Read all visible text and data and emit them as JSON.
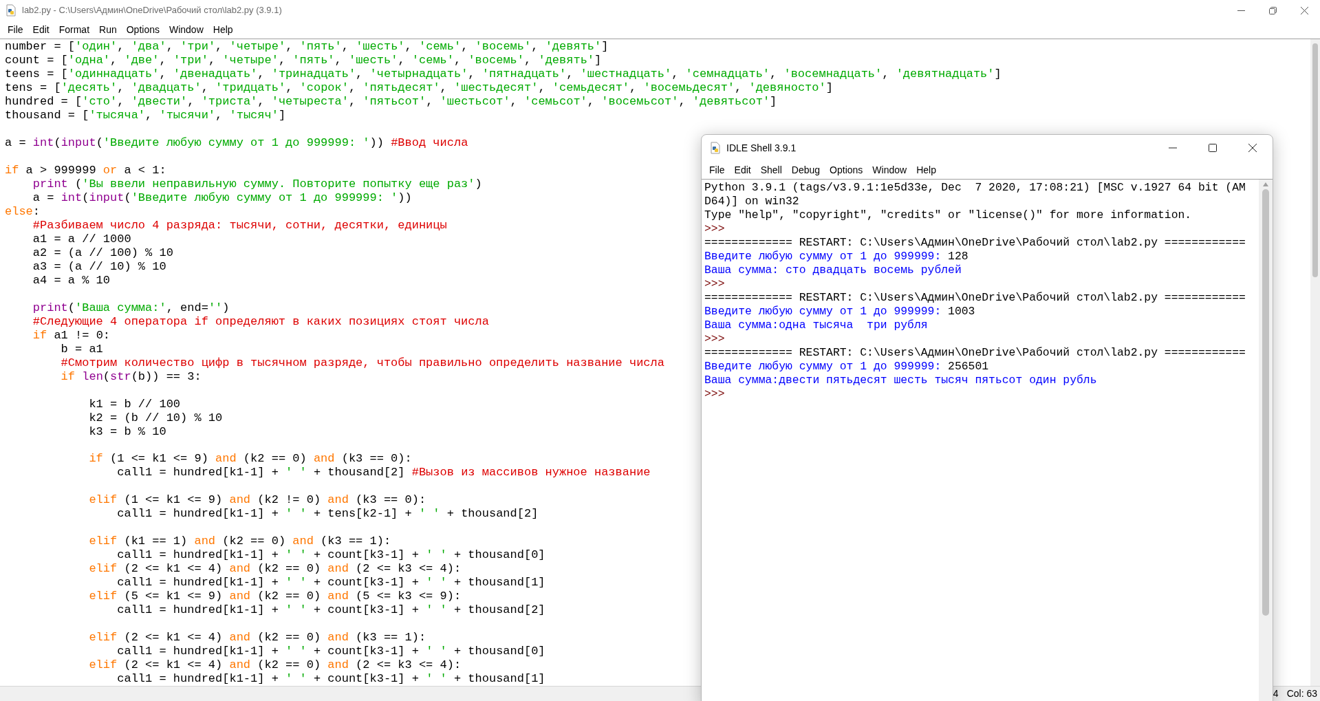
{
  "editor": {
    "title": "lab2.py - C:\\Users\\Админ\\OneDrive\\Рабочий стол\\lab2.py (3.9.1)",
    "menu": [
      "File",
      "Edit",
      "Format",
      "Run",
      "Options",
      "Window",
      "Help"
    ],
    "lines": [
      {
        "kind": "code",
        "tokens": [
          {
            "kind": "plain",
            "text": "number = ["
          },
          {
            "kind": "str",
            "text": "'один'"
          },
          {
            "kind": "plain",
            "text": ", "
          },
          {
            "kind": "str",
            "text": "'два'"
          },
          {
            "kind": "plain",
            "text": ", "
          },
          {
            "kind": "str",
            "text": "'три'"
          },
          {
            "kind": "plain",
            "text": ", "
          },
          {
            "kind": "str",
            "text": "'четыре'"
          },
          {
            "kind": "plain",
            "text": ", "
          },
          {
            "kind": "str",
            "text": "'пять'"
          },
          {
            "kind": "plain",
            "text": ", "
          },
          {
            "kind": "str",
            "text": "'шесть'"
          },
          {
            "kind": "plain",
            "text": ", "
          },
          {
            "kind": "str",
            "text": "'семь'"
          },
          {
            "kind": "plain",
            "text": ", "
          },
          {
            "kind": "str",
            "text": "'восемь'"
          },
          {
            "kind": "plain",
            "text": ", "
          },
          {
            "kind": "str",
            "text": "'девять'"
          },
          {
            "kind": "plain",
            "text": "]"
          }
        ]
      },
      {
        "kind": "code",
        "tokens": [
          {
            "kind": "plain",
            "text": "count = ["
          },
          {
            "kind": "str",
            "text": "'одна'"
          },
          {
            "kind": "plain",
            "text": ", "
          },
          {
            "kind": "str",
            "text": "'две'"
          },
          {
            "kind": "plain",
            "text": ", "
          },
          {
            "kind": "str",
            "text": "'три'"
          },
          {
            "kind": "plain",
            "text": ", "
          },
          {
            "kind": "str",
            "text": "'четыре'"
          },
          {
            "kind": "plain",
            "text": ", "
          },
          {
            "kind": "str",
            "text": "'пять'"
          },
          {
            "kind": "plain",
            "text": ", "
          },
          {
            "kind": "str",
            "text": "'шесть'"
          },
          {
            "kind": "plain",
            "text": ", "
          },
          {
            "kind": "str",
            "text": "'семь'"
          },
          {
            "kind": "plain",
            "text": ", "
          },
          {
            "kind": "str",
            "text": "'восемь'"
          },
          {
            "kind": "plain",
            "text": ", "
          },
          {
            "kind": "str",
            "text": "'девять'"
          },
          {
            "kind": "plain",
            "text": "]"
          }
        ]
      },
      {
        "kind": "code",
        "tokens": [
          {
            "kind": "plain",
            "text": "teens = ["
          },
          {
            "kind": "str",
            "text": "'одиннадцать'"
          },
          {
            "kind": "plain",
            "text": ", "
          },
          {
            "kind": "str",
            "text": "'двенадцать'"
          },
          {
            "kind": "plain",
            "text": ", "
          },
          {
            "kind": "str",
            "text": "'тринадцать'"
          },
          {
            "kind": "plain",
            "text": ", "
          },
          {
            "kind": "str",
            "text": "'четырнадцать'"
          },
          {
            "kind": "plain",
            "text": ", "
          },
          {
            "kind": "str",
            "text": "'пятнадцать'"
          },
          {
            "kind": "plain",
            "text": ", "
          },
          {
            "kind": "str",
            "text": "'шестнадцать'"
          },
          {
            "kind": "plain",
            "text": ", "
          },
          {
            "kind": "str",
            "text": "'семнадцать'"
          },
          {
            "kind": "plain",
            "text": ", "
          },
          {
            "kind": "str",
            "text": "'восемнадцать'"
          },
          {
            "kind": "plain",
            "text": ", "
          },
          {
            "kind": "str",
            "text": "'девятнадцать'"
          },
          {
            "kind": "plain",
            "text": "]"
          }
        ]
      },
      {
        "kind": "code",
        "tokens": [
          {
            "kind": "plain",
            "text": "tens = ["
          },
          {
            "kind": "str",
            "text": "'десять'"
          },
          {
            "kind": "plain",
            "text": ", "
          },
          {
            "kind": "str",
            "text": "'двадцать'"
          },
          {
            "kind": "plain",
            "text": ", "
          },
          {
            "kind": "str",
            "text": "'тридцать'"
          },
          {
            "kind": "plain",
            "text": ", "
          },
          {
            "kind": "str",
            "text": "'сорок'"
          },
          {
            "kind": "plain",
            "text": ", "
          },
          {
            "kind": "str",
            "text": "'пятьдесят'"
          },
          {
            "kind": "plain",
            "text": ", "
          },
          {
            "kind": "str",
            "text": "'шестьдесят'"
          },
          {
            "kind": "plain",
            "text": ", "
          },
          {
            "kind": "str",
            "text": "'семьдесят'"
          },
          {
            "kind": "plain",
            "text": ", "
          },
          {
            "kind": "str",
            "text": "'восемьдесят'"
          },
          {
            "kind": "plain",
            "text": ", "
          },
          {
            "kind": "str",
            "text": "'девяносто'"
          },
          {
            "kind": "plain",
            "text": "]"
          }
        ]
      },
      {
        "kind": "code",
        "tokens": [
          {
            "kind": "plain",
            "text": "hundred = ["
          },
          {
            "kind": "str",
            "text": "'сто'"
          },
          {
            "kind": "plain",
            "text": ", "
          },
          {
            "kind": "str",
            "text": "'двести'"
          },
          {
            "kind": "plain",
            "text": ", "
          },
          {
            "kind": "str",
            "text": "'триста'"
          },
          {
            "kind": "plain",
            "text": ", "
          },
          {
            "kind": "str",
            "text": "'четыреста'"
          },
          {
            "kind": "plain",
            "text": ", "
          },
          {
            "kind": "str",
            "text": "'пятьсот'"
          },
          {
            "kind": "plain",
            "text": ", "
          },
          {
            "kind": "str",
            "text": "'шестьсот'"
          },
          {
            "kind": "plain",
            "text": ", "
          },
          {
            "kind": "str",
            "text": "'семьсот'"
          },
          {
            "kind": "plain",
            "text": ", "
          },
          {
            "kind": "str",
            "text": "'восемьсот'"
          },
          {
            "kind": "plain",
            "text": ", "
          },
          {
            "kind": "str",
            "text": "'девятьсот'"
          },
          {
            "kind": "plain",
            "text": "]"
          }
        ]
      },
      {
        "kind": "code",
        "tokens": [
          {
            "kind": "plain",
            "text": "thousand = ["
          },
          {
            "kind": "str",
            "text": "'тысяча'"
          },
          {
            "kind": "plain",
            "text": ", "
          },
          {
            "kind": "str",
            "text": "'тысячи'"
          },
          {
            "kind": "plain",
            "text": ", "
          },
          {
            "kind": "str",
            "text": "'тысяч'"
          },
          {
            "kind": "plain",
            "text": "]"
          }
        ]
      },
      {
        "kind": "blank"
      },
      {
        "kind": "code",
        "tokens": [
          {
            "kind": "plain",
            "text": "a = "
          },
          {
            "kind": "builtin",
            "text": "int"
          },
          {
            "kind": "plain",
            "text": "("
          },
          {
            "kind": "builtin",
            "text": "input"
          },
          {
            "kind": "plain",
            "text": "("
          },
          {
            "kind": "str",
            "text": "'Введите любую сумму от 1 до 999999: '"
          },
          {
            "kind": "plain",
            "text": ")) "
          },
          {
            "kind": "comment",
            "text": "#Ввод числа"
          }
        ]
      },
      {
        "kind": "blank"
      },
      {
        "kind": "code",
        "tokens": [
          {
            "kind": "keyword",
            "text": "if"
          },
          {
            "kind": "plain",
            "text": " a > 999999 "
          },
          {
            "kind": "keyword",
            "text": "or"
          },
          {
            "kind": "plain",
            "text": " a < 1:"
          }
        ]
      },
      {
        "kind": "code",
        "tokens": [
          {
            "kind": "builtin",
            "text": "    print"
          },
          {
            "kind": "plain",
            "text": " ("
          },
          {
            "kind": "str",
            "text": "'Вы ввели неправильную сумму. Повторите попытку еще раз'"
          },
          {
            "kind": "plain",
            "text": ")"
          }
        ]
      },
      {
        "kind": "code",
        "tokens": [
          {
            "kind": "plain",
            "text": "    a = "
          },
          {
            "kind": "builtin",
            "text": "int"
          },
          {
            "kind": "plain",
            "text": "("
          },
          {
            "kind": "builtin",
            "text": "input"
          },
          {
            "kind": "plain",
            "text": "("
          },
          {
            "kind": "str",
            "text": "'Введите любую сумму от 1 до 999999: '"
          },
          {
            "kind": "plain",
            "text": "))"
          }
        ]
      },
      {
        "kind": "code",
        "tokens": [
          {
            "kind": "keyword",
            "text": "else"
          },
          {
            "kind": "plain",
            "text": ":"
          }
        ]
      },
      {
        "kind": "code",
        "tokens": [
          {
            "kind": "comment",
            "text": "    #Разбиваем число 4 разряда: тысячи, сотни, десятки, единицы"
          }
        ]
      },
      {
        "kind": "code",
        "tokens": [
          {
            "kind": "plain",
            "text": "    a1 = a // 1000"
          }
        ]
      },
      {
        "kind": "code",
        "tokens": [
          {
            "kind": "plain",
            "text": "    a2 = (a // 100) % 10"
          }
        ]
      },
      {
        "kind": "code",
        "tokens": [
          {
            "kind": "plain",
            "text": "    a3 = (a // 10) % 10"
          }
        ]
      },
      {
        "kind": "code",
        "tokens": [
          {
            "kind": "plain",
            "text": "    a4 = a % 10"
          }
        ]
      },
      {
        "kind": "blank"
      },
      {
        "kind": "code",
        "tokens": [
          {
            "kind": "builtin",
            "text": "    print"
          },
          {
            "kind": "plain",
            "text": "("
          },
          {
            "kind": "str",
            "text": "'Ваша сумма:'"
          },
          {
            "kind": "plain",
            "text": ", end="
          },
          {
            "kind": "str",
            "text": "''"
          },
          {
            "kind": "plain",
            "text": ")"
          }
        ]
      },
      {
        "kind": "code",
        "tokens": [
          {
            "kind": "comment",
            "text": "    #Следующие 4 оператора if определяют в каких позициях стоят числа"
          }
        ]
      },
      {
        "kind": "code",
        "tokens": [
          {
            "kind": "keyword",
            "text": "    if"
          },
          {
            "kind": "plain",
            "text": " a1 != 0:"
          }
        ]
      },
      {
        "kind": "code",
        "tokens": [
          {
            "kind": "plain",
            "text": "        b = a1"
          }
        ]
      },
      {
        "kind": "code",
        "tokens": [
          {
            "kind": "comment",
            "text": "        #Смотрим количество цифр в тысячном разряде, чтобы правильно определить название числа"
          }
        ]
      },
      {
        "kind": "code",
        "tokens": [
          {
            "kind": "keyword",
            "text": "        if"
          },
          {
            "kind": "builtin",
            "text": " len"
          },
          {
            "kind": "plain",
            "text": "("
          },
          {
            "kind": "builtin",
            "text": "str"
          },
          {
            "kind": "plain",
            "text": "(b)) == 3:"
          }
        ]
      },
      {
        "kind": "blank"
      },
      {
        "kind": "code",
        "tokens": [
          {
            "kind": "plain",
            "text": "            k1 = b // 100"
          }
        ]
      },
      {
        "kind": "code",
        "tokens": [
          {
            "kind": "plain",
            "text": "            k2 = (b // 10) % 10"
          }
        ]
      },
      {
        "kind": "code",
        "tokens": [
          {
            "kind": "plain",
            "text": "            k3 = b % 10"
          }
        ]
      },
      {
        "kind": "blank"
      },
      {
        "kind": "code",
        "tokens": [
          {
            "kind": "keyword",
            "text": "            if"
          },
          {
            "kind": "plain",
            "text": " (1 <= k1 <= 9) "
          },
          {
            "kind": "keyword",
            "text": "and"
          },
          {
            "kind": "plain",
            "text": " (k2 == 0) "
          },
          {
            "kind": "keyword",
            "text": "and"
          },
          {
            "kind": "plain",
            "text": " (k3 == 0):"
          }
        ]
      },
      {
        "kind": "code",
        "tokens": [
          {
            "kind": "plain",
            "text": "                call1 = hundred[k1-1] + "
          },
          {
            "kind": "str",
            "text": "' '"
          },
          {
            "kind": "plain",
            "text": " + thousand[2] "
          },
          {
            "kind": "comment",
            "text": "#Вызов из массивов нужное название"
          }
        ]
      },
      {
        "kind": "blank"
      },
      {
        "kind": "code",
        "tokens": [
          {
            "kind": "keyword",
            "text": "            elif"
          },
          {
            "kind": "plain",
            "text": " (1 <= k1 <= 9) "
          },
          {
            "kind": "keyword",
            "text": "and"
          },
          {
            "kind": "plain",
            "text": " (k2 != 0) "
          },
          {
            "kind": "keyword",
            "text": "and"
          },
          {
            "kind": "plain",
            "text": " (k3 == 0):"
          }
        ]
      },
      {
        "kind": "code",
        "tokens": [
          {
            "kind": "plain",
            "text": "                call1 = hundred[k1-1] + "
          },
          {
            "kind": "str",
            "text": "' '"
          },
          {
            "kind": "plain",
            "text": " + tens[k2-1] + "
          },
          {
            "kind": "str",
            "text": "' '"
          },
          {
            "kind": "plain",
            "text": " + thousand[2]"
          }
        ]
      },
      {
        "kind": "blank"
      },
      {
        "kind": "code",
        "tokens": [
          {
            "kind": "keyword",
            "text": "            elif"
          },
          {
            "kind": "plain",
            "text": " (k1 == 1) "
          },
          {
            "kind": "keyword",
            "text": "and"
          },
          {
            "kind": "plain",
            "text": " (k2 == 0) "
          },
          {
            "kind": "keyword",
            "text": "and"
          },
          {
            "kind": "plain",
            "text": " (k3 == 1):"
          }
        ]
      },
      {
        "kind": "code",
        "tokens": [
          {
            "kind": "plain",
            "text": "                call1 = hundred[k1-1] + "
          },
          {
            "kind": "str",
            "text": "' '"
          },
          {
            "kind": "plain",
            "text": " + count[k3-1] + "
          },
          {
            "kind": "str",
            "text": "' '"
          },
          {
            "kind": "plain",
            "text": " + thousand[0]"
          }
        ]
      },
      {
        "kind": "code",
        "tokens": [
          {
            "kind": "keyword",
            "text": "            elif"
          },
          {
            "kind": "plain",
            "text": " (2 <= k1 <= 4) "
          },
          {
            "kind": "keyword",
            "text": "and"
          },
          {
            "kind": "plain",
            "text": " (k2 == 0) "
          },
          {
            "kind": "keyword",
            "text": "and"
          },
          {
            "kind": "plain",
            "text": " (2 <= k3 <= 4):"
          }
        ]
      },
      {
        "kind": "code",
        "tokens": [
          {
            "kind": "plain",
            "text": "                call1 = hundred[k1-1] + "
          },
          {
            "kind": "str",
            "text": "' '"
          },
          {
            "kind": "plain",
            "text": " + count[k3-1] + "
          },
          {
            "kind": "str",
            "text": "' '"
          },
          {
            "kind": "plain",
            "text": " + thousand[1]"
          }
        ]
      },
      {
        "kind": "code",
        "tokens": [
          {
            "kind": "keyword",
            "text": "            elif"
          },
          {
            "kind": "plain",
            "text": " (5 <= k1 <= 9) "
          },
          {
            "kind": "keyword",
            "text": "and"
          },
          {
            "kind": "plain",
            "text": " (k2 == 0) "
          },
          {
            "kind": "keyword",
            "text": "and"
          },
          {
            "kind": "plain",
            "text": " (5 <= k3 <= 9):"
          }
        ]
      },
      {
        "kind": "code",
        "tokens": [
          {
            "kind": "plain",
            "text": "                call1 = hundred[k1-1] + "
          },
          {
            "kind": "str",
            "text": "' '"
          },
          {
            "kind": "plain",
            "text": " + count[k3-1] + "
          },
          {
            "kind": "str",
            "text": "' '"
          },
          {
            "kind": "plain",
            "text": " + thousand[2]"
          }
        ]
      },
      {
        "kind": "blank"
      },
      {
        "kind": "code",
        "tokens": [
          {
            "kind": "keyword",
            "text": "            elif"
          },
          {
            "kind": "plain",
            "text": " (2 <= k1 <= 4) "
          },
          {
            "kind": "keyword",
            "text": "and"
          },
          {
            "kind": "plain",
            "text": " (k2 == 0) "
          },
          {
            "kind": "keyword",
            "text": "and"
          },
          {
            "kind": "plain",
            "text": " (k3 == 1):"
          }
        ]
      },
      {
        "kind": "code",
        "tokens": [
          {
            "kind": "plain",
            "text": "                call1 = hundred[k1-1] + "
          },
          {
            "kind": "str",
            "text": "' '"
          },
          {
            "kind": "plain",
            "text": " + count[k3-1] + "
          },
          {
            "kind": "str",
            "text": "' '"
          },
          {
            "kind": "plain",
            "text": " + thousand[0]"
          }
        ]
      },
      {
        "kind": "code",
        "tokens": [
          {
            "kind": "keyword",
            "text": "            elif"
          },
          {
            "kind": "plain",
            "text": " (2 <= k1 <= 4) "
          },
          {
            "kind": "keyword",
            "text": "and"
          },
          {
            "kind": "plain",
            "text": " (k2 == 0) "
          },
          {
            "kind": "keyword",
            "text": "and"
          },
          {
            "kind": "plain",
            "text": " (2 <= k3 <= 4):"
          }
        ]
      },
      {
        "kind": "code",
        "tokens": [
          {
            "kind": "plain",
            "text": "                call1 = hundred[k1-1] + "
          },
          {
            "kind": "str",
            "text": "' '"
          },
          {
            "kind": "plain",
            "text": " + count[k3-1] + "
          },
          {
            "kind": "str",
            "text": "' '"
          },
          {
            "kind": "plain",
            "text": " + thousand[1]"
          }
        ]
      }
    ],
    "status_bar": [
      "4",
      "Col: 63"
    ]
  },
  "shell": {
    "title": "IDLE Shell 3.9.1",
    "menu": [
      "File",
      "Edit",
      "Shell",
      "Debug",
      "Options",
      "Window",
      "Help"
    ],
    "lines": [
      {
        "kind": "code",
        "tokens": [
          {
            "kind": "plain",
            "text": "Python 3.9.1 (tags/v3.9.1:1e5d33e, Dec  7 2020, 17:08:21) [MSC v.1927 64 bit (AM"
          }
        ]
      },
      {
        "kind": "code",
        "tokens": [
          {
            "kind": "plain",
            "text": "D64)] on win32"
          }
        ]
      },
      {
        "kind": "code",
        "tokens": [
          {
            "kind": "plain",
            "text": "Type \"help\", \"copyright\", \"credits\" or \"license()\" for more information."
          }
        ]
      },
      {
        "kind": "code",
        "tokens": [
          {
            "kind": "prompt",
            "text": ">>>"
          }
        ]
      },
      {
        "kind": "code",
        "tokens": [
          {
            "kind": "plain",
            "text": "============= RESTART: C:\\Users\\Админ\\OneDrive\\Рабочий стол\\lab2.py ============"
          }
        ]
      },
      {
        "kind": "code",
        "tokens": [
          {
            "kind": "output",
            "text": "Введите любую сумму от 1 до 999999: "
          },
          {
            "kind": "plain",
            "text": "128"
          }
        ]
      },
      {
        "kind": "code",
        "tokens": [
          {
            "kind": "output",
            "text": "Ваша сумма: сто двадцать восемь рублей"
          }
        ]
      },
      {
        "kind": "code",
        "tokens": [
          {
            "kind": "prompt",
            "text": ">>>"
          }
        ]
      },
      {
        "kind": "code",
        "tokens": [
          {
            "kind": "plain",
            "text": "============= RESTART: C:\\Users\\Админ\\OneDrive\\Рабочий стол\\lab2.py ============"
          }
        ]
      },
      {
        "kind": "code",
        "tokens": [
          {
            "kind": "output",
            "text": "Введите любую сумму от 1 до 999999: "
          },
          {
            "kind": "plain",
            "text": "1003"
          }
        ]
      },
      {
        "kind": "code",
        "tokens": [
          {
            "kind": "output",
            "text": "Ваша сумма:одна тысяча  три рубля"
          }
        ]
      },
      {
        "kind": "code",
        "tokens": [
          {
            "kind": "prompt",
            "text": ">>>"
          }
        ]
      },
      {
        "kind": "code",
        "tokens": [
          {
            "kind": "plain",
            "text": "============= RESTART: C:\\Users\\Админ\\OneDrive\\Рабочий стол\\lab2.py ============"
          }
        ]
      },
      {
        "kind": "code",
        "tokens": [
          {
            "kind": "output",
            "text": "Введите любую сумму от 1 до 999999: "
          },
          {
            "kind": "plain",
            "text": "256501"
          }
        ]
      },
      {
        "kind": "code",
        "tokens": [
          {
            "kind": "output",
            "text": "Ваша сумма:двести пятьдесят шесть тысяч пятьсот один рубль"
          }
        ]
      },
      {
        "kind": "code",
        "tokens": [
          {
            "kind": "prompt",
            "text": ">>>"
          }
        ]
      }
    ]
  }
}
